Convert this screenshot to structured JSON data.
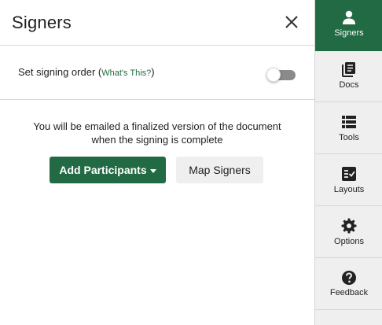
{
  "panel": {
    "title": "Signers",
    "close_icon": "close-icon"
  },
  "signing_order": {
    "label": "Set signing order (",
    "link": "What's This?",
    "label_end": ")",
    "enabled": false
  },
  "info": {
    "line1": "You will be emailed a finalized version of the document",
    "line2": "when the signing is complete"
  },
  "buttons": {
    "add_participants": "Add Participants",
    "map_signers": "Map Signers"
  },
  "sidebar": {
    "items": [
      {
        "label": "Signers",
        "icon": "person-icon",
        "active": true
      },
      {
        "label": "Docs",
        "icon": "documents-icon",
        "active": false
      },
      {
        "label": "Tools",
        "icon": "list-icon",
        "active": false
      },
      {
        "label": "Layouts",
        "icon": "checklist-icon",
        "active": false
      },
      {
        "label": "Options",
        "icon": "gear-icon",
        "active": false
      },
      {
        "label": "Feedback",
        "icon": "question-circle-icon",
        "active": false
      }
    ]
  },
  "colors": {
    "accent": "#216a43",
    "sidebar_bg": "#efefef",
    "toggle_off": "#8a8a8a"
  }
}
